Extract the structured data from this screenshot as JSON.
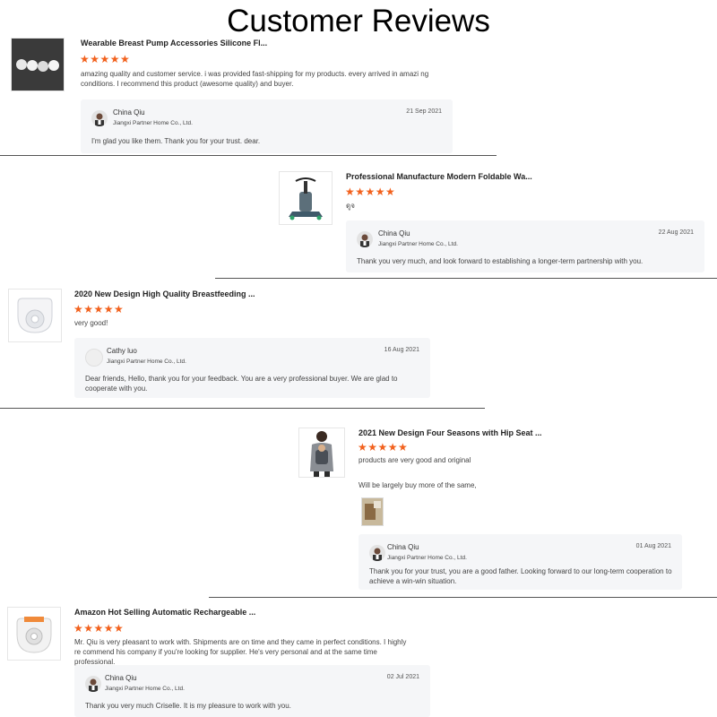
{
  "page": {
    "title": "Customer Reviews"
  },
  "colors": {
    "star": "#f2611d",
    "reply_bg": "#f5f6f8",
    "divider": "#555555"
  },
  "reviews": [
    {
      "product_title": "Wearable Breast Pump Accessories Silicone Fl...",
      "stars": "★★★★★",
      "text": "amazing quality and customer service. i was provided fast-shipping for my products. every arrived in amazi ng conditions. I recommend this product (awesome quality) and buyer.",
      "reply": {
        "name": "China Qiu",
        "company": "Jiangxi Partner Home Co., Ltd.",
        "date": "21 Sep 2021",
        "message": "I'm glad you like them. Thank you for your trust. dear."
      }
    },
    {
      "product_title": "Professional Manufacture Modern Foldable Wa...",
      "stars": "★★★★★",
      "text": "ดูจ",
      "reply": {
        "name": "China Qiu",
        "company": "Jiangxi Partner Home Co., Ltd.",
        "date": "22 Aug 2021",
        "message": "Thank you very much, and look forward to establishing a longer-term partnership with you."
      }
    },
    {
      "product_title": "2020 New Design High Quality Breastfeeding ...",
      "stars": "★★★★★",
      "text": "very good!",
      "reply": {
        "name": "Cathy luo",
        "company": "Jiangxi Partner Home Co., Ltd.",
        "date": "16 Aug 2021",
        "message": "Dear friends, Hello, thank you for your feedback. You are a very professional buyer. We are glad to cooperate with you."
      }
    },
    {
      "product_title": "2021 New Design Four Seasons with Hip Seat ...",
      "stars": "★★★★★",
      "text": "products are very good and original",
      "text2": "Will be largely buy more of the same,",
      "reply": {
        "name": "China Qiu",
        "company": "Jiangxi Partner Home Co., Ltd.",
        "date": "01 Aug 2021",
        "message": "Thank you for your trust, you are a good father. Looking forward to our long-term cooperation to achieve a win-win situation."
      }
    },
    {
      "product_title": "Amazon Hot Selling Automatic Rechargeable ...",
      "stars": "★★★★★",
      "text": "Mr. Qiu is very pleasant to work with. Shipments are on time and they came in perfect conditions. I highly re commend his company if you're looking for supplier. He's very personal and at the same time professional.",
      "reply": {
        "name": "China Qiu",
        "company": "Jiangxi Partner Home Co., Ltd.",
        "date": "02 Jul 2021",
        "message": "Thank you very much Criselle. It is my pleasure to work with you."
      }
    }
  ]
}
